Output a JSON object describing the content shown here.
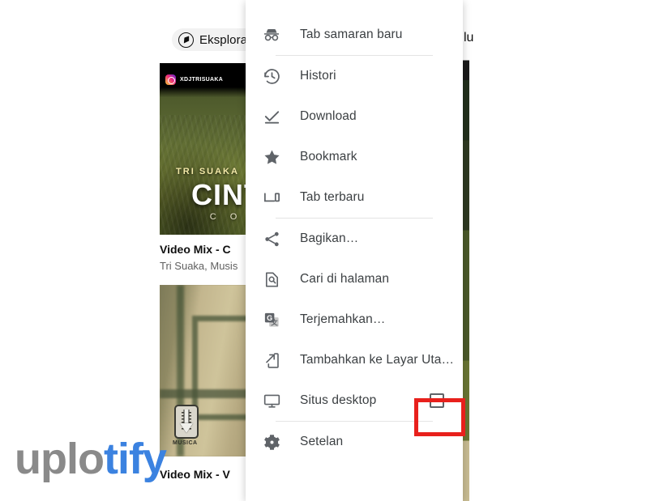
{
  "background": {
    "chip": {
      "label": "Eksplorasi",
      "icon": "compass-icon"
    },
    "card1": {
      "watermark_handle": "XDJTRISUAKA",
      "overlay_artist": "TRI SUAKA",
      "overlay_title": "CINT",
      "overlay_sub": "C O",
      "title": "Video Mix - C",
      "subtitle": "Tri Suaka, Musis"
    },
    "card2": {
      "badge_word": "MUSICA",
      "title": "Video Mix - V"
    },
    "right_edge_text": "lu"
  },
  "watermark": {
    "part1": "uplo",
    "part2": "tify",
    "color1": "#8a8a8a",
    "color2": "#3b82e0"
  },
  "menu": {
    "items": [
      {
        "label": "Tab samaran baru",
        "icon": "incognito-icon",
        "divider_after": true
      },
      {
        "label": "Histori",
        "icon": "history-icon",
        "divider_after": false
      },
      {
        "label": "Download",
        "icon": "download-check-icon",
        "divider_after": false
      },
      {
        "label": "Bookmark",
        "icon": "star-icon",
        "divider_after": false
      },
      {
        "label": "Tab terbaru",
        "icon": "recent-tabs-icon",
        "divider_after": true
      },
      {
        "label": "Bagikan…",
        "icon": "share-icon",
        "divider_after": false
      },
      {
        "label": "Cari di halaman",
        "icon": "find-in-page-icon",
        "divider_after": false
      },
      {
        "label": "Terjemahkan…",
        "icon": "translate-icon",
        "divider_after": false
      },
      {
        "label": "Tambahkan ke Layar Uta…",
        "icon": "add-to-home-screen-icon",
        "divider_after": false
      },
      {
        "label": "Situs desktop",
        "icon": "desktop-icon",
        "checkbox": true,
        "checked": false,
        "divider_after": true
      },
      {
        "label": "Setelan",
        "icon": "gear-icon",
        "divider_after": false
      }
    ]
  },
  "highlight": {
    "target": "situs-desktop-checkbox",
    "color": "#e8201c"
  }
}
